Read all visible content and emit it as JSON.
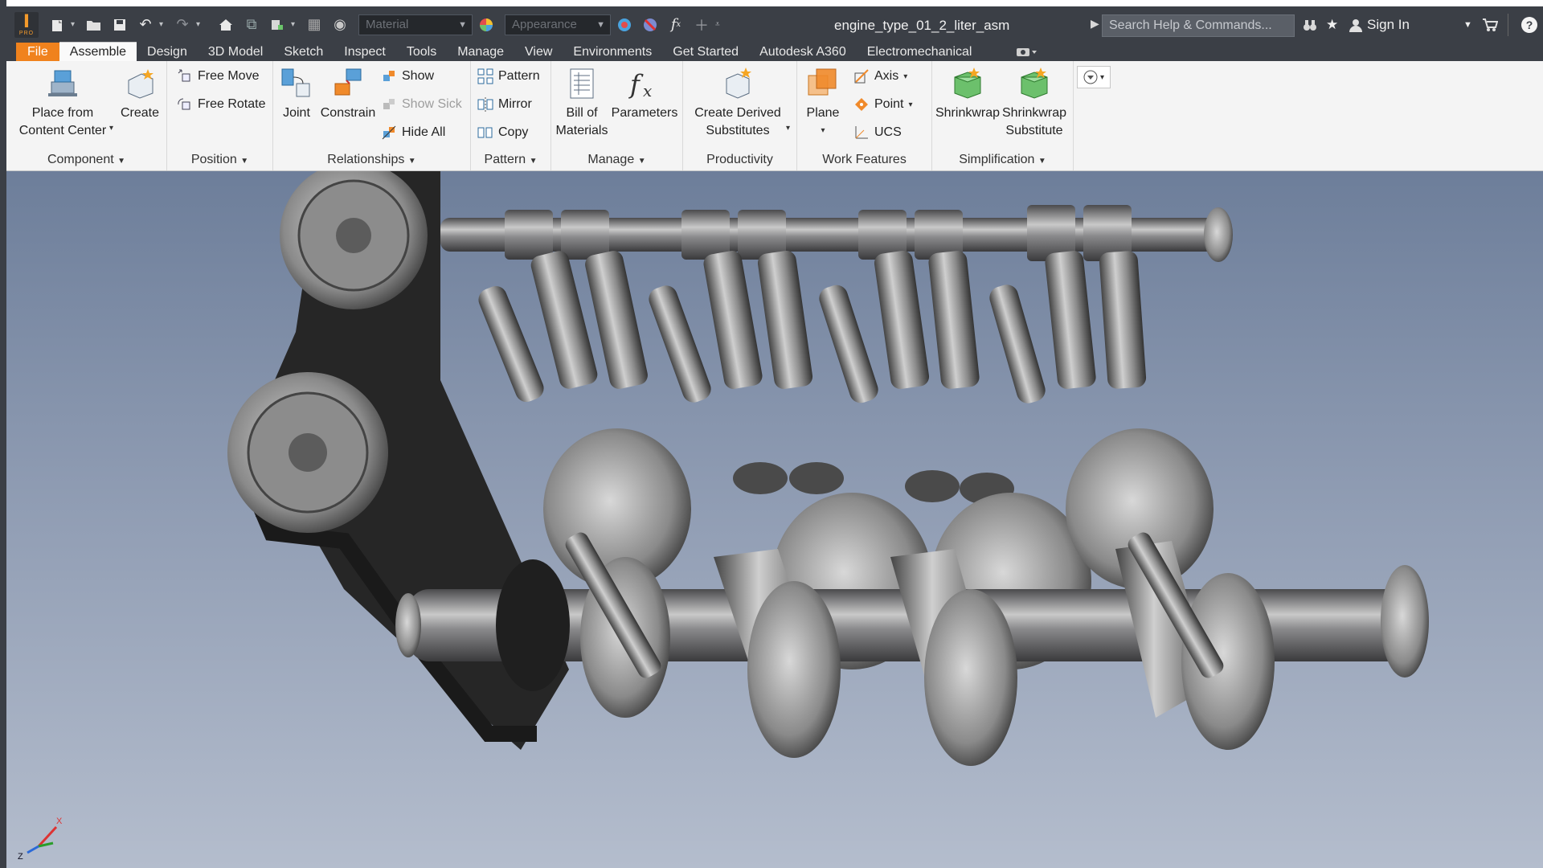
{
  "app": {
    "logo_letter": "I",
    "logo_sub": "PRO"
  },
  "title": "engine_type_01_2_liter_asm",
  "qat": {
    "material_placeholder": "Material",
    "appearance_placeholder": "Appearance"
  },
  "search": {
    "placeholder": "Search Help & Commands..."
  },
  "header_right": {
    "sign_in": "Sign In"
  },
  "tabs": [
    "File",
    "Assemble",
    "Design",
    "3D Model",
    "Sketch",
    "Inspect",
    "Tools",
    "Manage",
    "View",
    "Environments",
    "Get Started",
    "Autodesk A360",
    "Electromechanical"
  ],
  "ribbon": {
    "component": {
      "label": "Component",
      "place_line1": "Place from",
      "place_line2": "Content Center",
      "create": "Create"
    },
    "position": {
      "label": "Position",
      "free_move": "Free Move",
      "free_rotate": "Free Rotate"
    },
    "relationships": {
      "label": "Relationships",
      "joint": "Joint",
      "constrain": "Constrain",
      "show": "Show",
      "show_sick": "Show Sick",
      "hide_all": "Hide All"
    },
    "pattern": {
      "label": "Pattern",
      "pattern": "Pattern",
      "mirror": "Mirror",
      "copy": "Copy"
    },
    "manage": {
      "label": "Manage",
      "bom_line1": "Bill of",
      "bom_line2": "Materials",
      "parameters": "Parameters"
    },
    "productivity": {
      "label": "Productivity",
      "derived_line1": "Create Derived",
      "derived_line2": "Substitutes"
    },
    "work_features": {
      "label": "Work Features",
      "plane": "Plane",
      "axis": "Axis",
      "point": "Point",
      "ucs": "UCS"
    },
    "simplification": {
      "label": "Simplification",
      "shrinkwrap": "Shrinkwrap",
      "sub_line1": "Shrinkwrap",
      "sub_line2": "Substitute"
    }
  },
  "triad": {
    "x": "X",
    "z": "Z"
  }
}
